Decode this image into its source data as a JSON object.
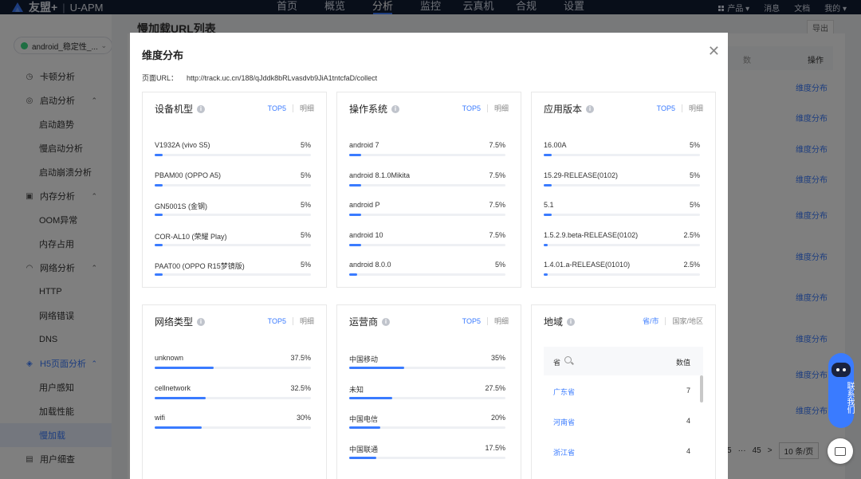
{
  "topbar": {
    "brand": "友盟+",
    "product": "U-APM",
    "nav": [
      "首页",
      "概览",
      "分析",
      "监控",
      "云真机",
      "合规",
      "设置"
    ],
    "active_nav": 2,
    "right": {
      "products": "产品",
      "messages": "消息",
      "docs": "文档",
      "mine": "我的"
    }
  },
  "sidebar": {
    "app_selector": "android_稳定性_...",
    "menu": [
      {
        "label": "卡顿分析",
        "type": "top",
        "icon": "stutter-icon"
      },
      {
        "label": "启动分析",
        "type": "top",
        "icon": "launch-icon",
        "expanded": true
      },
      {
        "label": "启动趋势",
        "type": "sub"
      },
      {
        "label": "慢启动分析",
        "type": "sub"
      },
      {
        "label": "启动崩溃分析",
        "type": "sub"
      },
      {
        "label": "内存分析",
        "type": "top",
        "icon": "memory-icon",
        "expanded": true
      },
      {
        "label": "OOM异常",
        "type": "sub"
      },
      {
        "label": "内存占用",
        "type": "sub"
      },
      {
        "label": "网络分析",
        "type": "top",
        "icon": "wifi-icon",
        "expanded": true
      },
      {
        "label": "HTTP",
        "type": "sub"
      },
      {
        "label": "网络错误",
        "type": "sub"
      },
      {
        "label": "DNS",
        "type": "sub"
      },
      {
        "label": "H5页面分析",
        "type": "top",
        "icon": "h5-icon",
        "expanded": true,
        "highlight": true
      },
      {
        "label": "用户感知",
        "type": "sub"
      },
      {
        "label": "加载性能",
        "type": "sub"
      },
      {
        "label": "慢加载",
        "type": "sub",
        "active": true
      },
      {
        "label": "用户细查",
        "type": "top",
        "icon": "user-detail-icon"
      }
    ]
  },
  "background": {
    "title": "慢加载URL列表",
    "export": "导出",
    "col_partial": "数",
    "col_action": "操作",
    "link_label": "维度分布",
    "pager": {
      "prev_page": "5",
      "ellipsis": "···",
      "last_page": "45",
      "next": ">",
      "page_size": "10 条/页"
    }
  },
  "modal": {
    "title": "维度分布",
    "url_label": "页面URL：",
    "url": "http://track.uc.cn/188/qJddk8bRLvasdvb9JiA1tntcfaD/collect",
    "cards": [
      {
        "title": "设备机型",
        "tab_a": "TOP5",
        "tab_b": "明细",
        "rows": [
          {
            "label": "V1932A (vivo S5)",
            "value": "5%",
            "pct": 5
          },
          {
            "label": "PBAM00 (OPPO A5)",
            "value": "5%",
            "pct": 5
          },
          {
            "label": "GN5001S (金钢)",
            "value": "5%",
            "pct": 5
          },
          {
            "label": "COR-AL10 (荣耀 Play)",
            "value": "5%",
            "pct": 5
          },
          {
            "label": "PAAT00 (OPPO R15梦镜版)",
            "value": "5%",
            "pct": 5
          }
        ]
      },
      {
        "title": "操作系统",
        "tab_a": "TOP5",
        "tab_b": "明细",
        "rows": [
          {
            "label": "android 7",
            "value": "7.5%",
            "pct": 7.5
          },
          {
            "label": "android 8.1.0Mikita",
            "value": "7.5%",
            "pct": 7.5
          },
          {
            "label": "android P",
            "value": "7.5%",
            "pct": 7.5
          },
          {
            "label": "android 10",
            "value": "7.5%",
            "pct": 7.5
          },
          {
            "label": "android 8.0.0",
            "value": "5%",
            "pct": 5
          }
        ]
      },
      {
        "title": "应用版本",
        "tab_a": "TOP5",
        "tab_b": "明细",
        "rows": [
          {
            "label": "16.00A",
            "value": "5%",
            "pct": 5
          },
          {
            "label": "15.29-RELEASE(0102)",
            "value": "5%",
            "pct": 5
          },
          {
            "label": "5.1",
            "value": "5%",
            "pct": 5
          },
          {
            "label": "1.5.2.9.beta-RELEASE(0102)",
            "value": "2.5%",
            "pct": 2.5
          },
          {
            "label": "1.4.01.a-RELEASE(01010)",
            "value": "2.5%",
            "pct": 2.5
          }
        ]
      },
      {
        "title": "网络类型",
        "tab_a": "TOP5",
        "tab_b": "明细",
        "rows": [
          {
            "label": "unknown",
            "value": "37.5%",
            "pct": 37.5
          },
          {
            "label": "cellnetwork",
            "value": "32.5%",
            "pct": 32.5
          },
          {
            "label": "wifi",
            "value": "30%",
            "pct": 30
          }
        ]
      },
      {
        "title": "运营商",
        "tab_a": "TOP5",
        "tab_b": "明细",
        "rows": [
          {
            "label": "中国移动",
            "value": "35%",
            "pct": 35
          },
          {
            "label": "未知",
            "value": "27.5%",
            "pct": 27.5
          },
          {
            "label": "中国电信",
            "value": "20%",
            "pct": 20
          },
          {
            "label": "中国联通",
            "value": "17.5%",
            "pct": 17.5
          }
        ]
      }
    ],
    "region": {
      "title": "地域",
      "tab_a": "省/市",
      "tab_b": "国家/地区",
      "col_name": "省",
      "col_value": "数值",
      "rows": [
        {
          "name": "广东省",
          "value": "7"
        },
        {
          "name": "河南省",
          "value": "4"
        },
        {
          "name": "浙江省",
          "value": "4"
        }
      ]
    }
  },
  "widgets": {
    "contact": "联系我们"
  },
  "colors": {
    "accent": "#3a7bff",
    "topbar": "#111c33"
  }
}
